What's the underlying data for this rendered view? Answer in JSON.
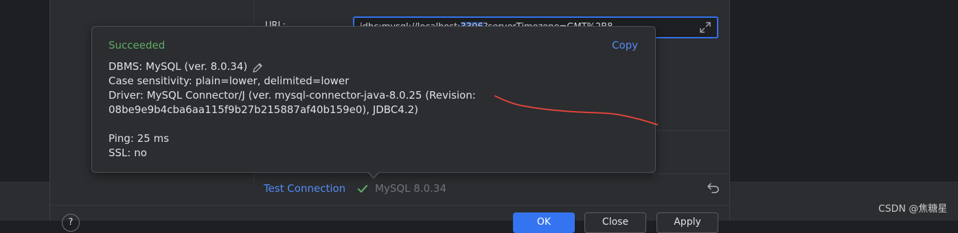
{
  "form": {
    "url_label": "URL:",
    "url_value_pre": "jdbc:mysql://localhost:",
    "url_value_sel": "3306",
    "url_value_post": "?serverTimezone=GMT%2B8"
  },
  "popup": {
    "title": "Succeeded",
    "copy_label": "Copy",
    "lines": {
      "dbms": "DBMS: MySQL (ver. 8.0.34)",
      "case": "Case sensitivity: plain=lower, delimited=lower",
      "driver": "Driver: MySQL Connector/J (ver. mysql-connector-java-8.0.25 (Revision:",
      "driver_cont": "08be9e9b4cba6aa115f9b27b215887af40b159e0), JDBC4.2)",
      "ping": "Ping: 25 ms",
      "ssl": "SSL: no"
    }
  },
  "test_connection": {
    "label": "Test Connection",
    "version": "MySQL 8.0.34"
  },
  "buttons": {
    "help": "?",
    "ok": "OK",
    "cancel": "Close",
    "apply": "Apply"
  },
  "watermark": "CSDN @焦糖星",
  "colors": {
    "accent": "#3574f0",
    "success": "#5fad65",
    "link": "#548af7",
    "annotation": "#e0443a"
  },
  "icons": [
    "expand-icon",
    "pencil-icon",
    "check-icon",
    "undo-icon"
  ]
}
